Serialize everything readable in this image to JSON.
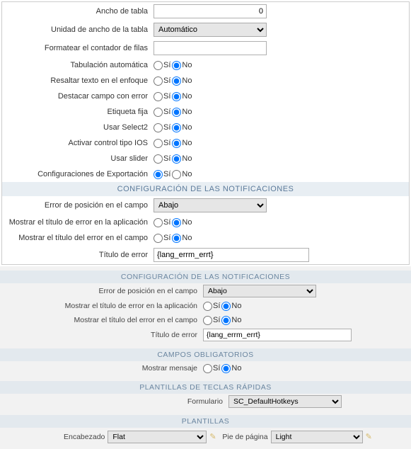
{
  "upper": {
    "table_width": {
      "label": "Ancho de tabla",
      "value": "0"
    },
    "table_width_unit": {
      "label": "Unidad de ancho de la tabla",
      "value": "Automático"
    },
    "row_counter_format": {
      "label": "Formatear el contador de filas",
      "value": ""
    },
    "auto_tab": {
      "label": "Tabulación automática",
      "yes": "Sí",
      "no": "No",
      "value": "no"
    },
    "highlight_focus": {
      "label": "Resaltar texto en el enfoque",
      "yes": "Sí",
      "no": "No",
      "value": "no"
    },
    "highlight_error": {
      "label": "Destacar campo con error",
      "yes": "Sí",
      "no": "No",
      "value": "no"
    },
    "fixed_label": {
      "label": "Etiqueta fija",
      "yes": "Sí",
      "no": "No",
      "value": "no"
    },
    "use_select2": {
      "label": "Usar Select2",
      "yes": "Sí",
      "no": "No",
      "value": "no"
    },
    "ios_control": {
      "label": "Activar control tipo IOS",
      "yes": "Sí",
      "no": "No",
      "value": "no"
    },
    "use_slider": {
      "label": "Usar slider",
      "yes": "Sí",
      "no": "No",
      "value": "no"
    },
    "export_config": {
      "label": "Configuraciones de Exportación",
      "yes": "Sí",
      "no": "No",
      "value": "yes"
    },
    "notif_header": "CONFIGURACIÓN DE LAS NOTIFICACIONES",
    "error_pos": {
      "label": "Error de posición en el campo",
      "value": "Abajo"
    },
    "show_err_app": {
      "label": "Mostrar el título de error en la aplicación",
      "yes": "Sí",
      "no": "No",
      "value": "no"
    },
    "show_err_field": {
      "label": "Mostrar el título del error en el campo",
      "yes": "Sí",
      "no": "No",
      "value": "no"
    },
    "error_title": {
      "label": "Título de error",
      "value": "{lang_errm_errt}"
    }
  },
  "lower": {
    "notif_header": "CONFIGURACIÓN DE LAS NOTIFICACIONES",
    "error_pos": {
      "label": "Error de posición en el campo",
      "value": "Abajo"
    },
    "show_err_app": {
      "label": "Mostrar el título de error en la aplicación",
      "yes": "Sí",
      "no": "No",
      "value": "no"
    },
    "show_err_field": {
      "label": "Mostrar el título del error en el campo",
      "yes": "Sí",
      "no": "No",
      "value": "no"
    },
    "error_title": {
      "label": "Título de error",
      "value": "{lang_errm_errt}"
    },
    "required_header": "CAMPOS OBLIGATORIOS",
    "show_message": {
      "label": "Mostrar mensaje",
      "yes": "Sí",
      "no": "No",
      "value": "no"
    },
    "hotkeys_header": "PLANTILLAS DE TECLAS RÁPIDAS",
    "form": {
      "label": "Formulario",
      "value": "SC_DefaultHotkeys"
    },
    "templates_header": "PLANTILLAS",
    "header_tpl": {
      "label": "Encabezado",
      "value": "Flat"
    },
    "footer_tpl": {
      "label": "Pie de página",
      "value": "Light"
    }
  }
}
